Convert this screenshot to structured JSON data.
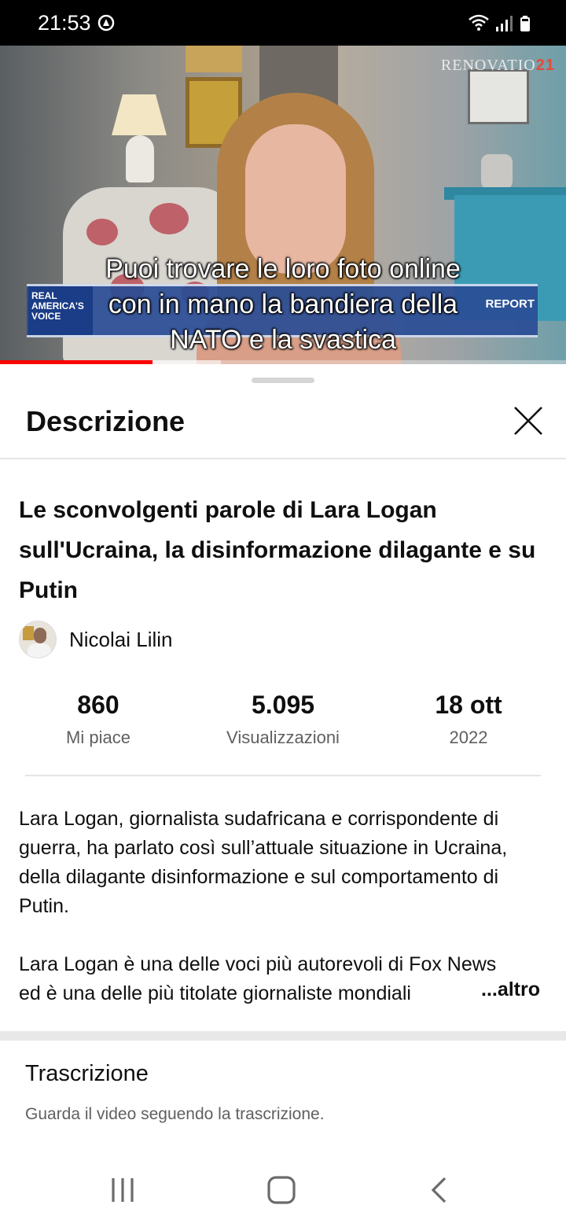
{
  "status_bar": {
    "time": "21:53",
    "icons": [
      "app-notification-icon",
      "wifi-icon",
      "signal-icon",
      "battery-icon"
    ]
  },
  "video": {
    "watermark_prefix": "RENOVATIO",
    "watermark_number": "21",
    "channel_logo_lines": [
      "REAL",
      "AMERICA'S",
      "VOICE"
    ],
    "banner_tag": "REPORT",
    "subtitle_lines": [
      "Puoi trovare le loro foto online",
      "con in mano la bandiera della",
      "NATO e la svastica"
    ],
    "progress_played": 0.27,
    "progress_buffered": 0.39
  },
  "sheet": {
    "title": "Descrizione",
    "close_icon": "close-icon"
  },
  "video_title": "Le sconvolgenti parole di Lara Logan sull'Ucraina, la disinformazione dilagante e su Putin",
  "channel": {
    "name": "Nicolai Lilin"
  },
  "stats": [
    {
      "value": "860",
      "label": "Mi piace"
    },
    {
      "value": "5.095",
      "label": "Visualizzazioni"
    },
    {
      "value": "18 ott",
      "label": "2022"
    }
  ],
  "description": {
    "paragraph1": "Lara Logan, giornalista sudafricana e corrispondente di guerra, ha parlato così sull’attuale situazione in Ucraina, della dilagante disinformazione e sul comportamento di Putin.",
    "paragraph2_line1": "Lara Logan è una delle voci più autorevoli di Fox News",
    "paragraph2_line2": "ed è una delle più titolate giornaliste mondiali",
    "more_label": "...altro"
  },
  "transcript": {
    "title": "Trascrizione",
    "subtitle": "Guarda il video seguendo la trascrizione."
  },
  "nav_bar": {
    "icons": [
      "recent-apps-icon",
      "home-icon",
      "back-icon"
    ]
  },
  "colors": {
    "progress": "#ff0000",
    "text_primary": "#0f0f0f",
    "text_secondary": "#606060"
  }
}
